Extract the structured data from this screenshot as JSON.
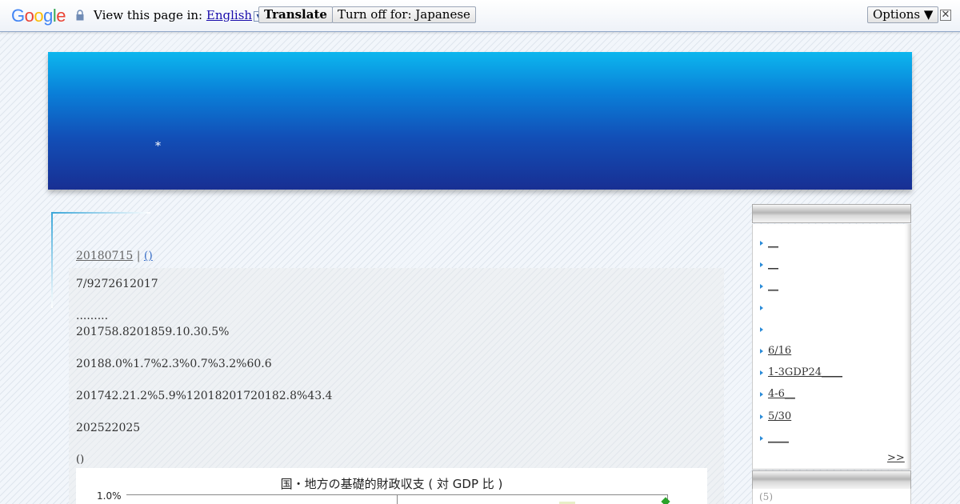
{
  "translate_bar": {
    "logo": "Google",
    "prompt": "View this page in:",
    "language": "English",
    "translate_label": "Translate",
    "turn_off_label": "Turn off for: Japanese",
    "options_label": "Options ▼",
    "close_glyph": "✕"
  },
  "banner": {
    "mark": "*"
  },
  "post": {
    "date": "20180715",
    "separator": "|",
    "category": "()",
    "lines": [
      "7/9272612017",
      ".........",
      "201758.8201859.10.30.5%",
      "20188.0%1.7%2.3%0.7%3.2%60.6",
      "201742.21.2%5.9%12018201720182.8%43.4",
      "202522025",
      "()"
    ],
    "chart": {
      "title": "国・地方の基礎的財政収支 ( 対 GDP 比 )",
      "tick": "1.0%",
      "marker_color": "#2aa22a"
    }
  },
  "sidebar": {
    "items": [
      {
        "label": "__"
      },
      {
        "label": "__"
      },
      {
        "label": "__"
      },
      {
        "label": ""
      },
      {
        "label": ""
      },
      {
        "label": "6/16"
      },
      {
        "label": "1-3GDP24____"
      },
      {
        "label": "4-6__"
      },
      {
        "label": "5/30"
      },
      {
        "label": "____"
      }
    ],
    "more_label": ">>",
    "next_item": "(5)"
  },
  "colors": {
    "accent": "#2a8bd8",
    "banner_top": "#0cb7ee",
    "banner_bottom": "#182f93"
  }
}
